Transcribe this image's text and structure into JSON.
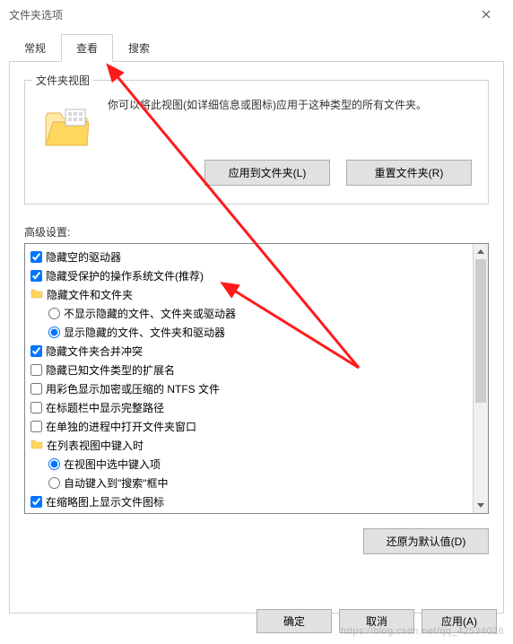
{
  "window": {
    "title": "文件夹选项"
  },
  "tabs": {
    "general": "常规",
    "view": "查看",
    "search": "搜索",
    "active": "view"
  },
  "folderView": {
    "legend": "文件夹视图",
    "description": "你可以将此视图(如详细信息或图标)应用于这种类型的所有文件夹。",
    "applyBtn": "应用到文件夹(L)",
    "resetBtn": "重置文件夹(R)"
  },
  "advanced": {
    "label": "高级设置:",
    "items": [
      {
        "type": "checkbox",
        "checked": true,
        "indent": 0,
        "label": "隐藏空的驱动器"
      },
      {
        "type": "checkbox",
        "checked": true,
        "indent": 0,
        "label": "隐藏受保护的操作系统文件(推荐)"
      },
      {
        "type": "folder",
        "indent": 0,
        "label": "隐藏文件和文件夹"
      },
      {
        "type": "radio",
        "checked": false,
        "indent": 1,
        "label": "不显示隐藏的文件、文件夹或驱动器"
      },
      {
        "type": "radio",
        "checked": true,
        "indent": 1,
        "label": "显示隐藏的文件、文件夹和驱动器"
      },
      {
        "type": "checkbox",
        "checked": true,
        "indent": 0,
        "label": "隐藏文件夹合并冲突"
      },
      {
        "type": "checkbox",
        "checked": false,
        "indent": 0,
        "label": "隐藏已知文件类型的扩展名"
      },
      {
        "type": "checkbox",
        "checked": false,
        "indent": 0,
        "label": "用彩色显示加密或压缩的 NTFS 文件"
      },
      {
        "type": "checkbox",
        "checked": false,
        "indent": 0,
        "label": "在标题栏中显示完整路径"
      },
      {
        "type": "checkbox",
        "checked": false,
        "indent": 0,
        "label": "在单独的进程中打开文件夹窗口"
      },
      {
        "type": "folder",
        "indent": 0,
        "label": "在列表视图中键入时"
      },
      {
        "type": "radio",
        "checked": true,
        "indent": 1,
        "label": "在视图中选中键入项"
      },
      {
        "type": "radio",
        "checked": false,
        "indent": 1,
        "label": "自动键入到\"搜索\"框中"
      },
      {
        "type": "checkbox",
        "checked": true,
        "indent": 0,
        "label": "在缩略图上显示文件图标"
      }
    ],
    "restoreBtn": "还原为默认值(D)"
  },
  "footer": {
    "ok": "确定",
    "cancel": "取消",
    "apply": "应用(A)"
  },
  "watermark": "https://blog.csdn.net/qq_42534026"
}
